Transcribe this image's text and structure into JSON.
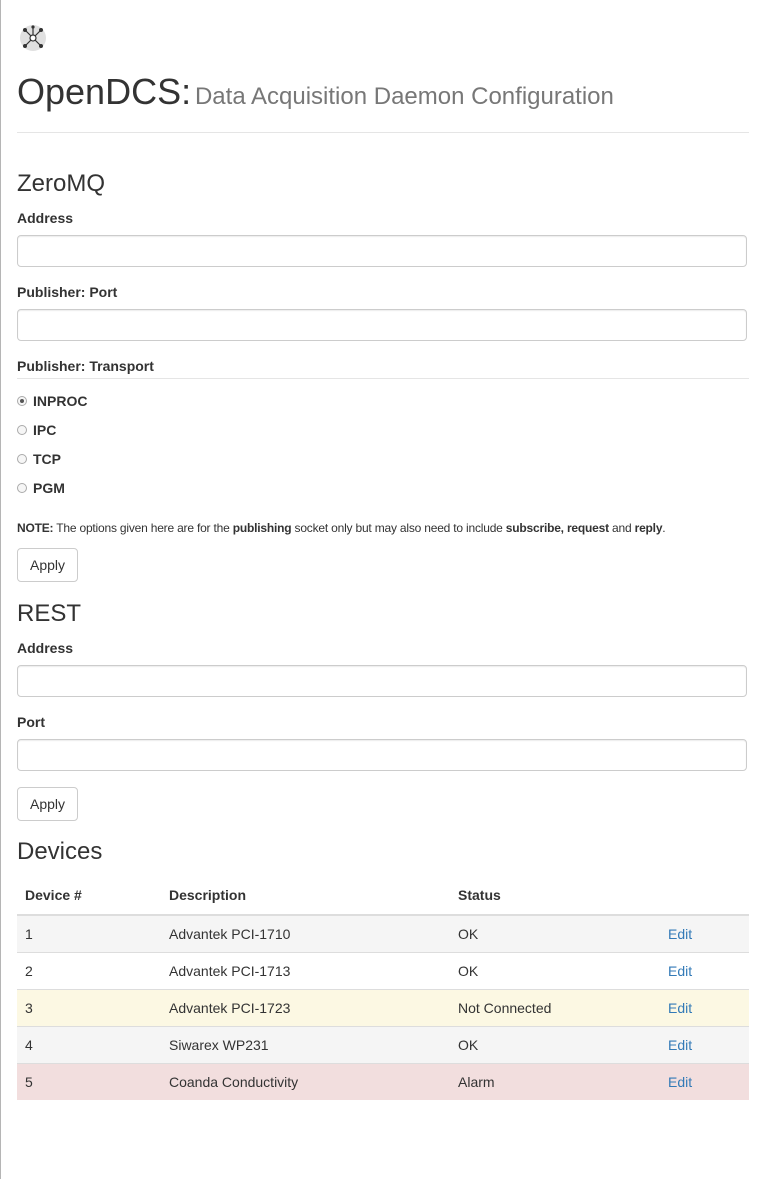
{
  "header": {
    "logo_icon": "network-nodes-icon",
    "brand": "OpenDCS:",
    "subtitle": "Data Acquisition Daemon Configuration"
  },
  "zeromq": {
    "title": "ZeroMQ",
    "address_label": "Address",
    "address_value": "",
    "port_label": "Publisher: Port",
    "port_value": "",
    "transport_label": "Publisher: Transport",
    "transports": [
      {
        "label": "INPROC",
        "checked": true
      },
      {
        "label": "IPC",
        "checked": false
      },
      {
        "label": "TCP",
        "checked": false
      },
      {
        "label": "PGM",
        "checked": false
      }
    ],
    "note": {
      "prefix": "NOTE:",
      "t1": " The options given here are for the ",
      "b1": "publishing",
      "t2": " socket only but may also need to include ",
      "b2": "subscribe, request",
      "t3": " and ",
      "b3": "reply",
      "t4": "."
    },
    "apply_label": "Apply"
  },
  "rest": {
    "title": "REST",
    "address_label": "Address",
    "address_value": "",
    "port_label": "Port",
    "port_value": "",
    "apply_label": "Apply"
  },
  "devices": {
    "title": "Devices",
    "columns": [
      "Device #",
      "Description",
      "Status",
      ""
    ],
    "rows": [
      {
        "num": "1",
        "description": "Advantek PCI-1710",
        "status": "OK",
        "action": "Edit",
        "style": "default"
      },
      {
        "num": "2",
        "description": "Advantek PCI-1713",
        "status": "OK",
        "action": "Edit",
        "style": "white"
      },
      {
        "num": "3",
        "description": "Advantek PCI-1723",
        "status": "Not Connected",
        "action": "Edit",
        "style": "warning"
      },
      {
        "num": "4",
        "description": "Siwarex WP231",
        "status": "OK",
        "action": "Edit",
        "style": "default"
      },
      {
        "num": "5",
        "description": "Coanda Conductivity",
        "status": "Alarm",
        "action": "Edit",
        "style": "danger"
      }
    ]
  },
  "colors": {
    "link": "#337ab7",
    "warning_row": "#fcf8e3",
    "danger_row": "#f2dede",
    "striped_row": "#f5f5f5"
  }
}
